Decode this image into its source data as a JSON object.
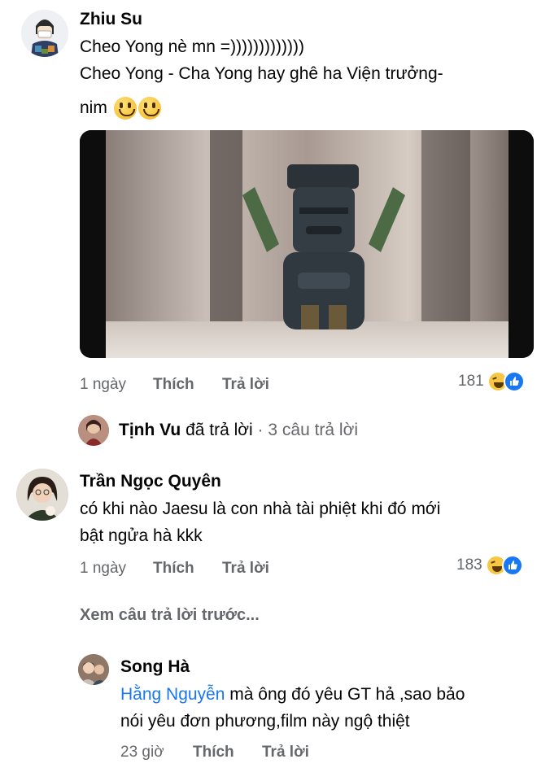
{
  "comments": [
    {
      "author": "Zhiu Su",
      "lines": [
        "Cheo Yong nè mn =)))))))))))))",
        "Cheo Yong - Cha Yong hay ghê ha Viện trưởng-",
        "nim"
      ],
      "time": "1 ngày",
      "like_label": "Thích",
      "reply_label": "Trả lời",
      "reaction_count": "181"
    },
    {
      "author": "Trần Ngọc Quyên",
      "lines": [
        "có khi nào Jaesu là con nhà tài phiệt khi đó mới",
        "bật ngửa hà kkk"
      ],
      "time": "1 ngày",
      "like_label": "Thích",
      "reply_label": "Trả lời",
      "reaction_count": "183"
    }
  ],
  "reply_summary": {
    "name": "Tịnh Vu",
    "action": "đã trả lời",
    "count": "· 3 câu trả lời"
  },
  "view_previous": "Xem câu trả lời trước...",
  "reply": {
    "author": "Song Hà",
    "mention": "Hằng Nguyễn",
    "line1_rest": " mà ông đó yêu GT hả ,sao bảo",
    "line2": "nói yêu đơn phương,film này ngộ thiệt",
    "time": "23 giờ",
    "like_label": "Thích",
    "reply_label": "Trả lời"
  },
  "colors": {
    "meta_gray": "#65676b",
    "mention_blue": "#1877f2",
    "like_blue": "#1877f2",
    "haha_yellow": "#f7c644"
  }
}
